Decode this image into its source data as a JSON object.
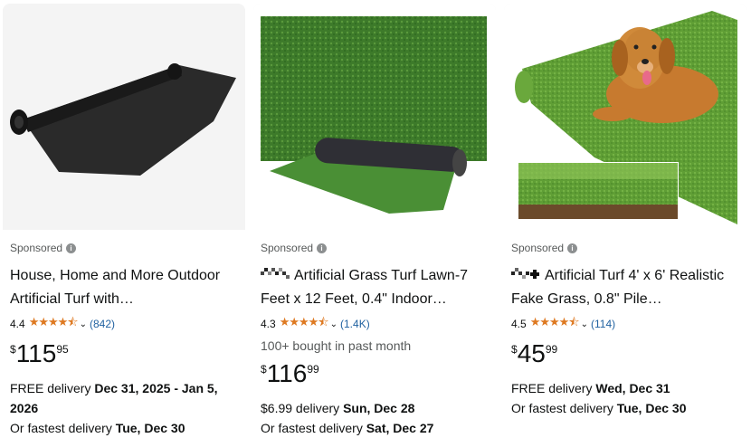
{
  "cards": [
    {
      "sponsored": "Sponsored",
      "brand": "",
      "title": "House, Home and More Outdoor Artificial Turf with…",
      "rating": "4.4",
      "rating_count": "(842)",
      "bought": "",
      "price_symbol": "$",
      "price_whole": "115",
      "price_fraction": "95",
      "delivery_prefix": "FREE delivery ",
      "delivery_date": "Dec 31, 2025 - Jan 5, 2026",
      "fastest_prefix": "Or fastest delivery ",
      "fastest_date": "Tue, Dec 30"
    },
    {
      "sponsored": "Sponsored",
      "brand": "logo",
      "title": "Artificial Grass Turf Lawn-7 Feet x 12 Feet, 0.4\" Indoor…",
      "rating": "4.3",
      "rating_count": "(1.4K)",
      "bought": "100+ bought in past month",
      "price_symbol": "$",
      "price_whole": "116",
      "price_fraction": "99",
      "delivery_prefix": "$6.99 delivery ",
      "delivery_date": "Sun, Dec 28",
      "fastest_prefix": "Or fastest delivery ",
      "fastest_date": "Sat, Dec 27"
    },
    {
      "sponsored": "Sponsored",
      "brand": "logo",
      "title": "Artificial Turf 4' x 6' Realistic Fake Grass, 0.8\" Pile…",
      "rating": "4.5",
      "rating_count": "(114)",
      "bought": "",
      "price_symbol": "$",
      "price_whole": "45",
      "price_fraction": "99",
      "delivery_prefix": "FREE delivery ",
      "delivery_date": "Wed, Dec 31",
      "fastest_prefix": "Or fastest delivery ",
      "fastest_date": "Tue, Dec 30"
    }
  ],
  "stars_glyph": "★★★★⯪",
  "chevron_glyph": "⌄",
  "info_glyph": "i",
  "colors": {
    "star": "#de7921",
    "link": "#2162a1",
    "muted": "#565959",
    "grass": "#3f7f2c"
  }
}
